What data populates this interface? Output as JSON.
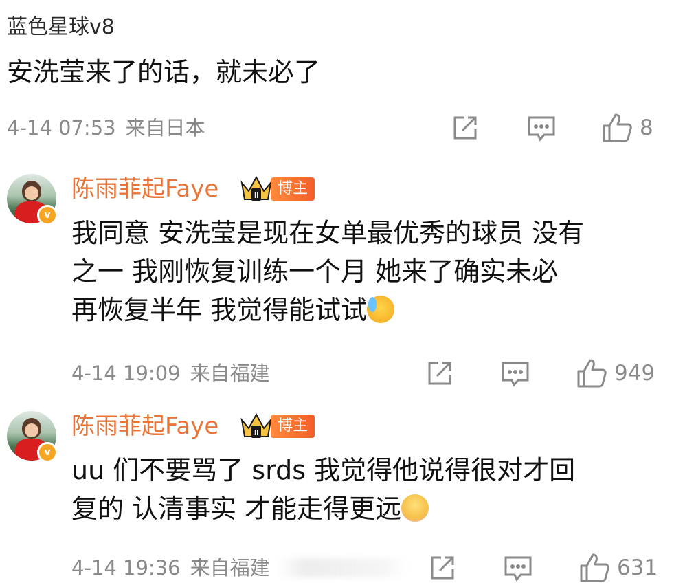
{
  "top_comment": {
    "username": "蓝色星球v8",
    "text": "安洗莹来了的话，就未必了",
    "date": "4-14 07:53",
    "location": "来自日本",
    "likes": "8"
  },
  "replies": [
    {
      "username": "陈雨菲起Faye",
      "badge": "博主",
      "crown_text": "II",
      "verified_mark": "v",
      "lines": [
        "我同意 安洗莹是现在女单最优秀的球员 没有",
        "之一 我刚恢复训练一个月 她来了确实未必",
        "再恢复半年 我觉得能试试"
      ],
      "emoji": "cry-laugh-icon",
      "date": "4-14 19:09",
      "location": "来自福建",
      "likes": "949"
    },
    {
      "username": "陈雨菲起Faye",
      "badge": "博主",
      "crown_text": "II",
      "verified_mark": "v",
      "lines": [
        "uu 们不要骂了 srds 我觉得他说得很对才回",
        "复的 认清事实 才能走得更远"
      ],
      "emoji": "smile-icon",
      "date": "4-14 19:36",
      "location": "来自福建",
      "likes": "631"
    }
  ],
  "icons": {
    "share": "share-icon",
    "comment": "comment-icon",
    "like": "thumbs-up-icon"
  },
  "colors": {
    "username_accent": "#e8763a",
    "meta_gray": "#8a8a8a",
    "badge_orange": "#f25f2a",
    "verified_yellow": "#f6a623"
  }
}
